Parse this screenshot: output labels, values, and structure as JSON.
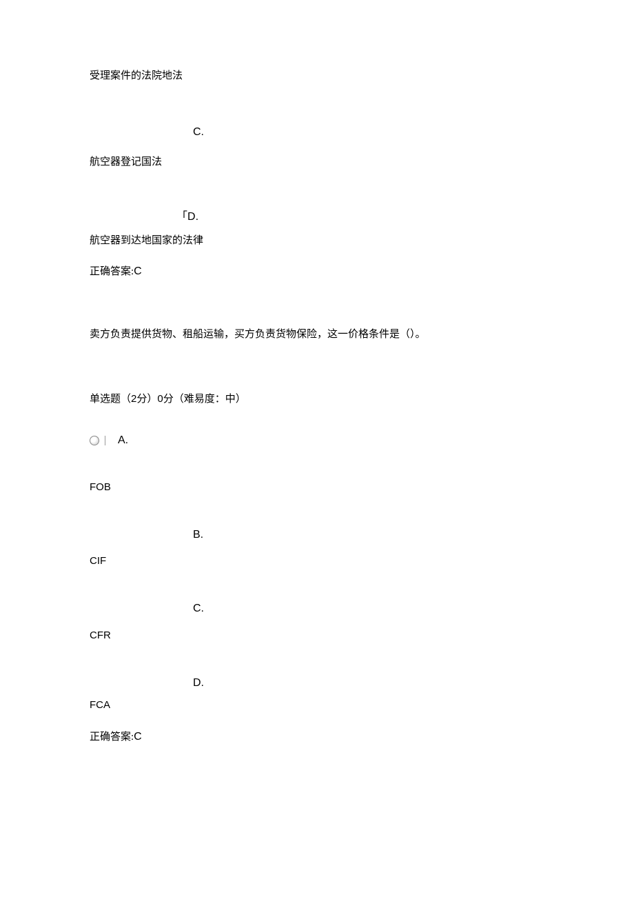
{
  "q1": {
    "optB_text": "受理案件的法院地法",
    "optC_letter": "C.",
    "optC_text": "航空器登记国法",
    "optD_letter": "D.",
    "optD_text": "航空器到达地国家的法律",
    "answer_label": "正确答案:",
    "answer_value": "C"
  },
  "q2": {
    "stem": "卖方负责提供货物、租船运输，买方负责货物保险，这一价格条件是（）。",
    "meta_prefix": "单选题（",
    "meta_points": "2",
    "meta_mid1": "分）",
    "meta_score": "0",
    "meta_mid2": "分（难易度：中）",
    "optA_letter": "A.",
    "optA_text": "FOB",
    "optB_letter": "B.",
    "optB_text": "CIF",
    "optC_letter": "C.",
    "optC_text": "CFR",
    "optD_letter": "D.",
    "optD_text": "FCA",
    "answer_label": "正确答案:",
    "answer_value": "C"
  }
}
